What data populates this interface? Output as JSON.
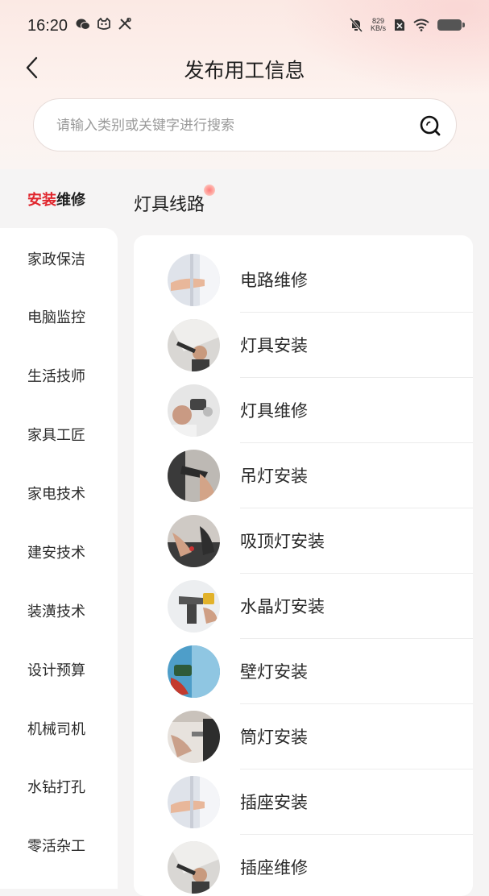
{
  "status_bar": {
    "time": "16:20",
    "net_speed_value": "829",
    "net_speed_unit": "KB/s",
    "left_icons": [
      "wechat-icon",
      "cat-icon",
      "tools-icon"
    ],
    "right_icons": [
      "mute-bell-icon",
      "sim-icon",
      "wifi-icon",
      "battery-icon"
    ]
  },
  "header": {
    "title": "发布用工信息"
  },
  "search": {
    "placeholder": "请输入类别或关键字进行搜索"
  },
  "sidebar": {
    "active": {
      "part_a": "安装",
      "part_b": "维修"
    },
    "items": [
      {
        "label": "家政保洁"
      },
      {
        "label": "电脑监控"
      },
      {
        "label": "生活技师"
      },
      {
        "label": "家具工匠"
      },
      {
        "label": "家电技术"
      },
      {
        "label": "建安技术"
      },
      {
        "label": "装潢技术"
      },
      {
        "label": "设计预算"
      },
      {
        "label": "机械司机"
      },
      {
        "label": "水钻打孔"
      },
      {
        "label": "零活杂工"
      }
    ]
  },
  "subcategory": {
    "title": "灯具线路"
  },
  "services": [
    {
      "label": "电路维修",
      "thumb": "hand-wall"
    },
    {
      "label": "灯具安装",
      "thumb": "ceiling-worker"
    },
    {
      "label": "灯具维修",
      "thumb": "drill-worker"
    },
    {
      "label": "吊灯安装",
      "thumb": "tool-closeup"
    },
    {
      "label": "吸顶灯安装",
      "thumb": "hands-tools"
    },
    {
      "label": "水晶灯安装",
      "thumb": "drill-yellow"
    },
    {
      "label": "壁灯安装",
      "thumb": "blue-wall-drill"
    },
    {
      "label": "筒灯安装",
      "thumb": "window-curtain"
    },
    {
      "label": "插座安装",
      "thumb": "hand-wall"
    },
    {
      "label": "插座维修",
      "thumb": "ceiling-worker"
    }
  ],
  "colors": {
    "accent_red": "#e0252c",
    "header_gradient": "#fbe9e4",
    "page_bg": "#f5f4f4"
  }
}
